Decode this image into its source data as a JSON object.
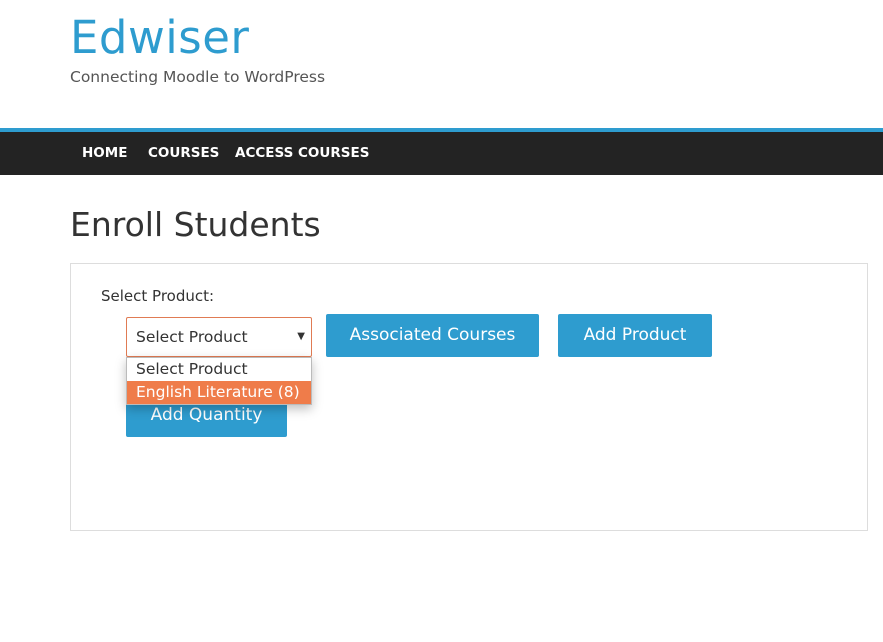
{
  "site": {
    "title": "Edwiser",
    "tagline": "Connecting Moodle to WordPress"
  },
  "nav": {
    "items": [
      {
        "label": "HOME"
      },
      {
        "label": "COURSES"
      },
      {
        "label": "ACCESS COURSES"
      }
    ]
  },
  "page": {
    "title": "Enroll Students"
  },
  "form": {
    "select_label": "Select Product:",
    "select_value": "Select Product",
    "options": [
      {
        "label": "Select Product",
        "highlighted": false
      },
      {
        "label": "English Literature (8)",
        "highlighted": true
      }
    ],
    "associated_courses_label": "Associated Courses",
    "add_product_label": "Add Product",
    "add_quantity_label": "Add Quantity"
  },
  "icons": {
    "caret": "chevron-down-icon"
  },
  "colors": {
    "brand": "#2e9ccf",
    "navbar": "#232323",
    "highlight": "#ef7c4a",
    "select_border": "#e07b53"
  }
}
